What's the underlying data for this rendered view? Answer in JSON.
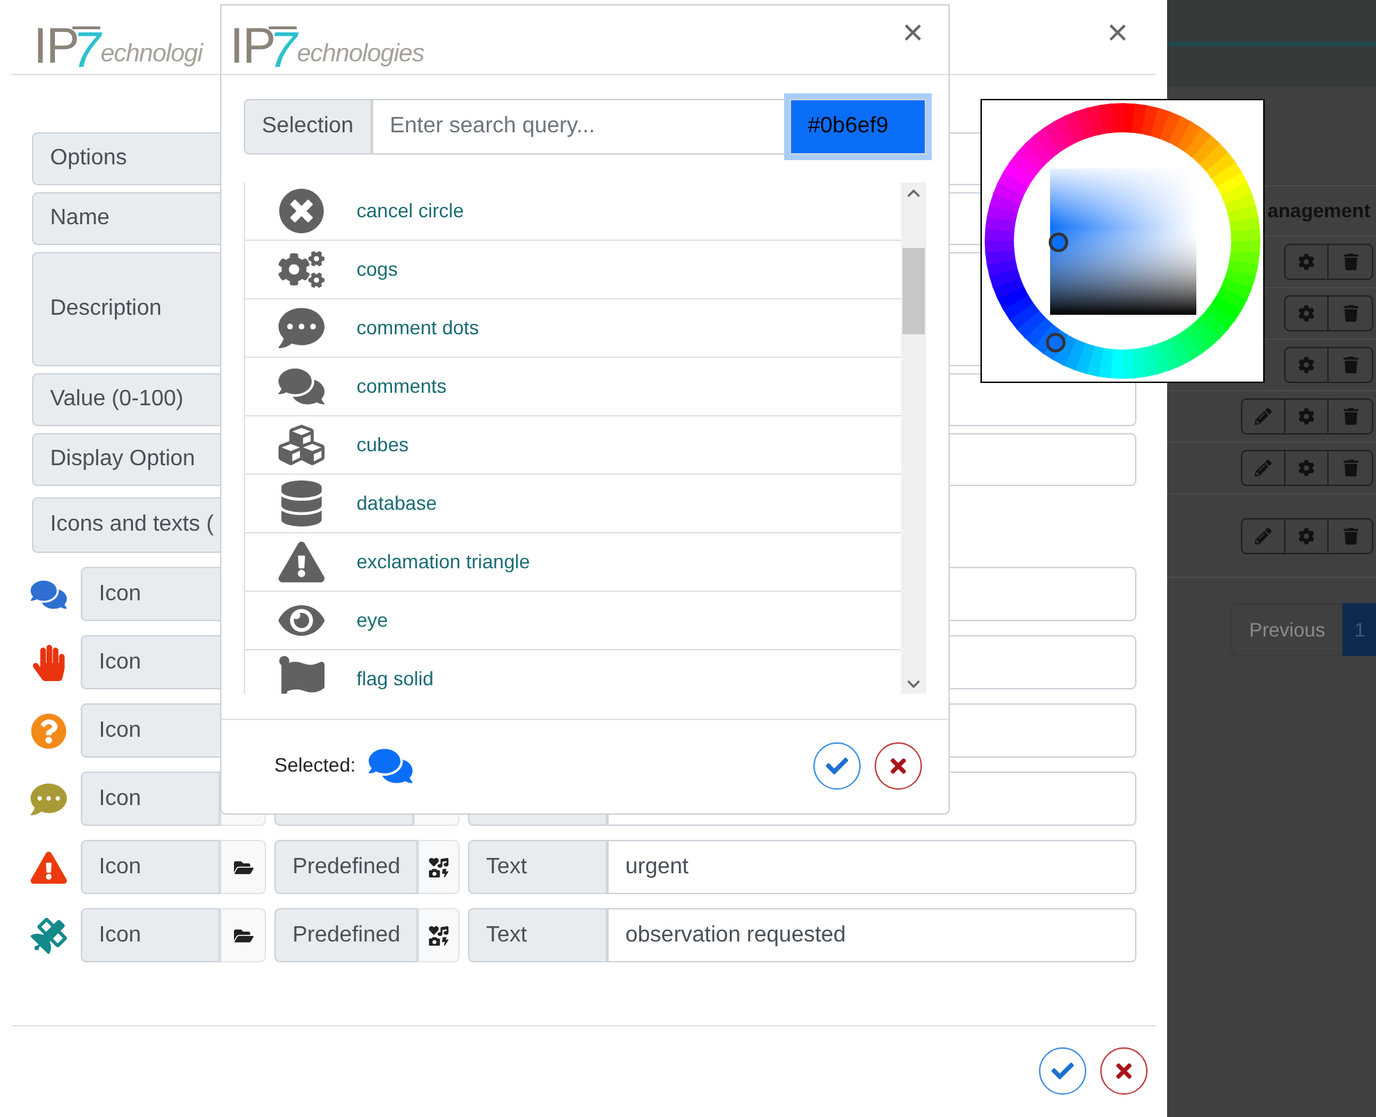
{
  "background_page": {
    "column_header": "anagement",
    "pager": {
      "previous": "Previous",
      "page": "1"
    }
  },
  "main_dialog": {
    "logo": {
      "brand": "IP",
      "digit": "7",
      "tail": "echnologi"
    },
    "close": "×",
    "fields": [
      {
        "label": "Options",
        "kind": "input"
      },
      {
        "label": "Name",
        "kind": "input"
      },
      {
        "label": "Description",
        "kind": "textarea"
      },
      {
        "label": "Value (0-100)",
        "kind": "input"
      },
      {
        "label": "Display Option",
        "kind": "input"
      },
      {
        "label": "Icons and texts (",
        "kind": "heading"
      }
    ],
    "icon_rows": [
      {
        "color": "#2f6fd1",
        "icon_label": "Icon"
      },
      {
        "color": "#e8340f",
        "icon_label": "Icon"
      },
      {
        "color": "#f28a1a",
        "icon_label": "Icon"
      },
      {
        "color": "#a89a35",
        "icon_label": "Icon"
      },
      {
        "color": "#ec3a0d",
        "icon_label": "Icon",
        "predefined_label": "Predefined",
        "text_label": "Text",
        "value": "urgent"
      },
      {
        "color": "#13898a",
        "icon_label": "Icon",
        "predefined_label": "Predefined",
        "text_label": "Text",
        "value": "observation requested"
      }
    ]
  },
  "icon_picker": {
    "logo": {
      "brand": "IP",
      "digit": "7",
      "tail": "echnologies"
    },
    "close": "×",
    "search_label": "Selection",
    "search": {
      "placeholder": "Enter search query..."
    },
    "color_value": "#0b6ef9",
    "items": [
      "cancel circle",
      "cogs",
      "comment dots",
      "comments",
      "cubes",
      "database",
      "exclamation triangle",
      "eye",
      "flag solid"
    ],
    "selected_label": "Selected:"
  }
}
